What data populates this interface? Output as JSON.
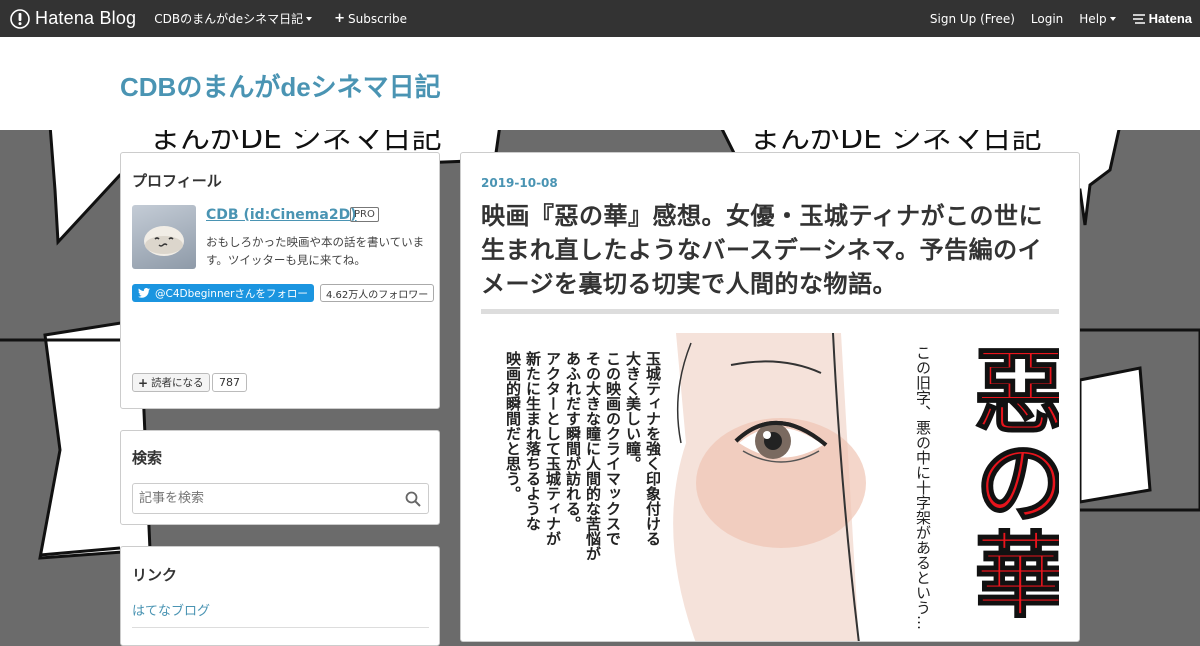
{
  "globalbar": {
    "brand": "Hatena Blog",
    "blog_menu": "CDBのまんがdeシネマ日記",
    "subscribe": "Subscribe",
    "signup": "Sign Up (Free)",
    "login": "Login",
    "help": "Help",
    "hatena": "Hatena"
  },
  "header": {
    "title": "CDBのまんがdeシネマ日記"
  },
  "background_art": {
    "top_left_text": "まんがDE シネマ日記",
    "top_right_text": "まんがDE シネマ日記"
  },
  "profile": {
    "title": "プロフィール",
    "name": "CDB (id:Cinema2D)",
    "badge": "PRO",
    "description": "おもしろかった映画や本の話を書いています。ツイッターも見に来てね。",
    "twitter_follow": "@C4Dbeginnerさんをフォロー",
    "twitter_count": "4.62万人のフォロワー",
    "reader_button": "読者になる",
    "reader_count": "787"
  },
  "search": {
    "title": "検索",
    "placeholder": "記事を検索"
  },
  "links": {
    "title": "リンク",
    "items": [
      "はてなブログ"
    ]
  },
  "article": {
    "date": "2019-10-08",
    "title": "映画『惡の華』感想。女優・玉城ティナがこの世に生まれ直したようなバースデーシネマ。予告編のイメージを裏切る切実で人間的な物語。",
    "image": {
      "vertical_text": [
        "玉城ティナを強く印象付ける",
        "大きく美しい瞳。",
        "この映画のクライマックスで",
        "その大きな瞳に人間的な苦悩が",
        "あふれだす瞬間が訪れる。",
        "アクターとして玉城ティナが",
        "新たに生まれ落ちるような",
        "映画的瞬間だと思う。"
      ],
      "handwritten_note": "この旧字、悪の中に十字架があるという…",
      "big_title": "惡の華"
    }
  },
  "colors": {
    "topbar": "#333333",
    "accent": "#4a94b3",
    "background": "#6b6b6b",
    "title_red": "#e8141c"
  }
}
